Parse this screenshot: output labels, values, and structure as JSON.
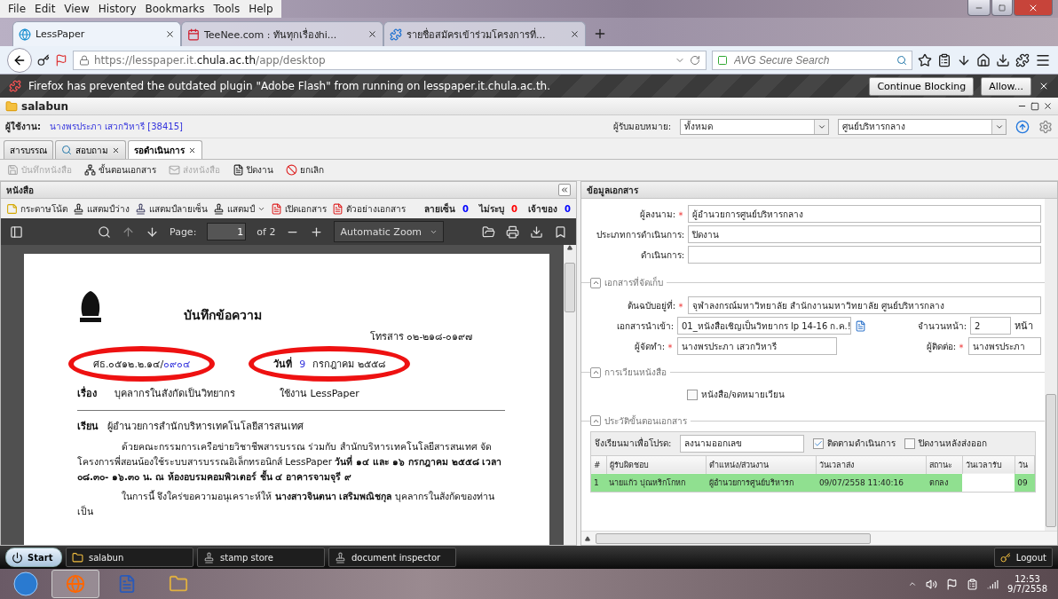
{
  "browser": {
    "menu": [
      "File",
      "Edit",
      "View",
      "History",
      "Bookmarks",
      "Tools",
      "Help"
    ],
    "tabs": [
      {
        "title": "LessPaper",
        "selected": true
      },
      {
        "title": "TeeNee.com : ทันทุกเรื่องhi...",
        "selected": false
      },
      {
        "title": "รายชื่อสมัครเข้าร่วมโครงการที่...",
        "selected": false
      }
    ],
    "url": {
      "scheme": "https://lesspaper.it.",
      "domain": "chula.ac.th",
      "path": "/app/desktop"
    },
    "search": {
      "placeholder": "AVG Secure Search"
    },
    "notification": {
      "message": "Firefox has prevented the outdated plugin \"Adobe Flash\" from running on lesspaper.it.chula.ac.th.",
      "buttons": [
        "Continue Blocking",
        "Allow..."
      ]
    }
  },
  "app": {
    "title": "salabun",
    "user_label": "ผู้ใช้งาน:",
    "user": "นางพรประภา เสวกวิหารี [38415]",
    "assignee_label": "ผู้รับมอบหมาย:",
    "assignee_filters": [
      "ทั้งหมด",
      "ศูนย์บริหารกลาง"
    ],
    "tabs": [
      {
        "label": "สารบรรณ",
        "selected": false,
        "closable": false
      },
      {
        "label": "สอบถาม",
        "selected": false,
        "closable": true
      },
      {
        "label": "รอดำเนินการ",
        "selected": true,
        "closable": true
      }
    ],
    "toolbar": [
      {
        "label": "บันทึกหนังสือ",
        "disabled": true
      },
      {
        "label": "ขั้นตอนเอกสาร",
        "disabled": false
      },
      {
        "label": "ส่งหนังสือ",
        "disabled": true
      },
      {
        "label": "ปิดงาน",
        "disabled": false
      },
      {
        "label": "ยกเลิก",
        "disabled": false
      }
    ]
  },
  "letter_panel": {
    "title": "หนังสือ",
    "tools": [
      "กระดาษโน้ต",
      "แสตมป์ว่าง",
      "แสตมป์ลายเซ็น",
      "แสตมป์",
      "เปิดเอกสาร",
      "ตัวอย่างเอกสาร"
    ],
    "counters": [
      {
        "label": "ลายเซ็น",
        "value": "0",
        "color": "#0000ff"
      },
      {
        "label": "ไม่ระบุ",
        "value": "0",
        "color": "#ff0000"
      },
      {
        "label": "เจ้าของ",
        "value": "0",
        "color": "#0000ff"
      }
    ]
  },
  "viewer": {
    "page_label": "Page:",
    "page": "1",
    "page_count": "of 2",
    "zoom": "Automatic Zoom",
    "document": {
      "heading": "บันทึกข้อความ",
      "fax": "โทรสาร ๐๒-๒๑๘-๐๑๙๗",
      "ref": "ศธ.๐๕๑๒.๒.๑๔/",
      "ref_number": "๐๙๐๔",
      "date_label": "วันที่",
      "date_day": "9",
      "date_rest": "กรกฎาคม ๒๕๕๘",
      "subject_label": "เรื่อง",
      "subject_parts": [
        "บุคลากรในสังกัดเป็นวิทยากร",
        "ใช้งาน LessPaper"
      ],
      "to_label": "เรียน",
      "to": "ผู้อำนวยการสำนักบริหารเทคโนโลยีสารสนเทศ",
      "paragraphs": [
        "ด้วยคณะกรรมการเครือข่ายวิชาชีพสารบรรณ ร่วมกับ สำนักบริหารเทคโนโลยีสารสนเทศ จัดโครงการพี่สอนน้องใช้ระบบสารบรรณอิเล็กทรอนิกส์ LessPaper **วันที่ ๑๔ และ ๑๖ กรกฎาคม ๒๕๕๘ เวลา ๐๘.๓๐- ๑๖.๓๐ น. ณ ห้องอบรมคอมพิวเตอร์ ชั้น ๔ อาคารจามจุรี ๙**",
        "ในการนี้ จึงใคร่ขอความอนุเคราะห์ให้ **นางสาวจินตนา  เสริมพณิชกุล** บุคลากรในสังกัดของท่านเป็น"
      ]
    }
  },
  "doc_info": {
    "title": "ข้อมูลเอกสาร",
    "fields": [
      {
        "label": "ผู้ลงนาม:",
        "required": true,
        "value": "ผู้อำนวยการศูนย์บริหารกลาง"
      },
      {
        "label": "ประเภทการดำเนินการ:",
        "required": false,
        "value": "ปิดงาน"
      },
      {
        "label": "ดำเนินการ:",
        "required": false
      }
    ]
  },
  "storage": {
    "title": "เอกสารที่จัดเก็บ",
    "expanded": true,
    "original": {
      "label": "ต้นฉบับอยู่ที่:",
      "required": true,
      "value": "จุฬาลงกรณ์มหาวิทยาลัย สำนักงานมหาวิทยาลัย ศูนย์บริหารกลาง"
    },
    "import": {
      "label": "เอกสารนำเข้า:",
      "required": false,
      "value": "01_หนังสือเชิญเป็นวิทยากร  lp 14-16 ก.ค.!"
    },
    "pages": {
      "label": "จำนวนหน้า:",
      "required": false,
      "value": "2",
      "unit": "หน้า"
    },
    "author": {
      "label": "ผู้จัดทำ:",
      "required": true,
      "value": "นางพรประภา เสวกวิหารี"
    },
    "contact": {
      "label": "ผู้ติดต่อ:",
      "required": true,
      "value": "นางพรประภา"
    }
  },
  "circulation": {
    "title": "การเวียนหนังสือ",
    "expanded": true,
    "checkbox": {
      "label": "หนังสือ/จดหมายเวียน",
      "checked": false
    }
  },
  "history": {
    "title": "ประวัติขั้นตอนเอกสาร",
    "expanded": true,
    "purpose_label": "จึงเรียนมาเพื่อโปรด:",
    "purpose": "ลงนามออกเลข",
    "options": [
      {
        "label": "ติดตามดำเนินการ",
        "checked": true
      },
      {
        "label": "ปิดงานหลังส่งออก",
        "checked": false
      }
    ],
    "columns": [
      "#",
      "ผู้รับผิดชอบ",
      "ตำแหน่ง/ส่วนงาน",
      "วันเวลาส่ง",
      "สถานะ",
      "วันเวลารับ",
      "วัน"
    ],
    "rows": [
      {
        "cells": [
          "1",
          "นายแก้ว ปุณหริกโกหก",
          "ผู้อำนวยการศูนย์บริหารก",
          "09/07/2558 11:40:16",
          "ตกลง",
          null,
          "09"
        ],
        "selected": true
      }
    ]
  },
  "app_taskbar": {
    "start": "Start",
    "windows": [
      "salabun",
      "stamp store",
      "document inspector"
    ],
    "logout": "Logout"
  },
  "os_taskbar": {
    "time": "12:53",
    "date": "9/7/2558"
  }
}
